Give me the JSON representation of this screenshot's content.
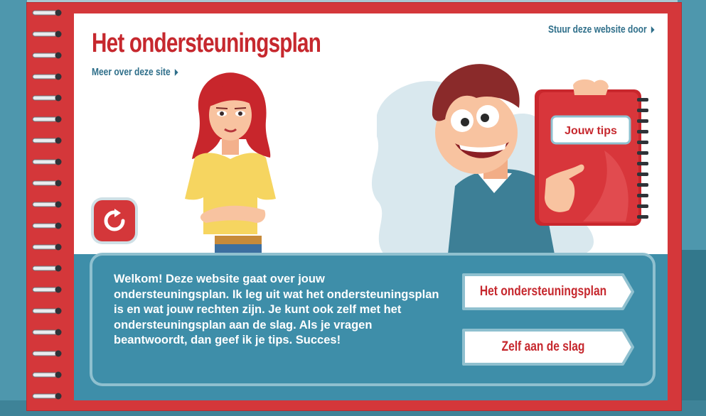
{
  "header": {
    "title": "Het ondersteuningsplan",
    "more_link": "Meer over deze site",
    "share_link": "Stuur deze website door"
  },
  "illustration": {
    "notebook_label": "Jouw tips"
  },
  "welcome": {
    "text": "Welkom! Deze website gaat over jouw ondersteuningsplan. Ik leg uit wat het ondersteuningsplan is en wat jouw rechten zijn. Je kunt ook zelf met het ondersteuningsplan aan de slag. Als je vragen beantwoordt, dan geef ik je tips. Succes!"
  },
  "buttons": {
    "primary": "Het ondersteuningsplan",
    "secondary": "Zelf aan de slag"
  },
  "icons": {
    "reload": "reload-icon",
    "arrow": "triangle-right-icon"
  },
  "colors": {
    "accent_red": "#c6282e",
    "teal": "#3e8ea9",
    "link_blue": "#2f6f8a"
  }
}
